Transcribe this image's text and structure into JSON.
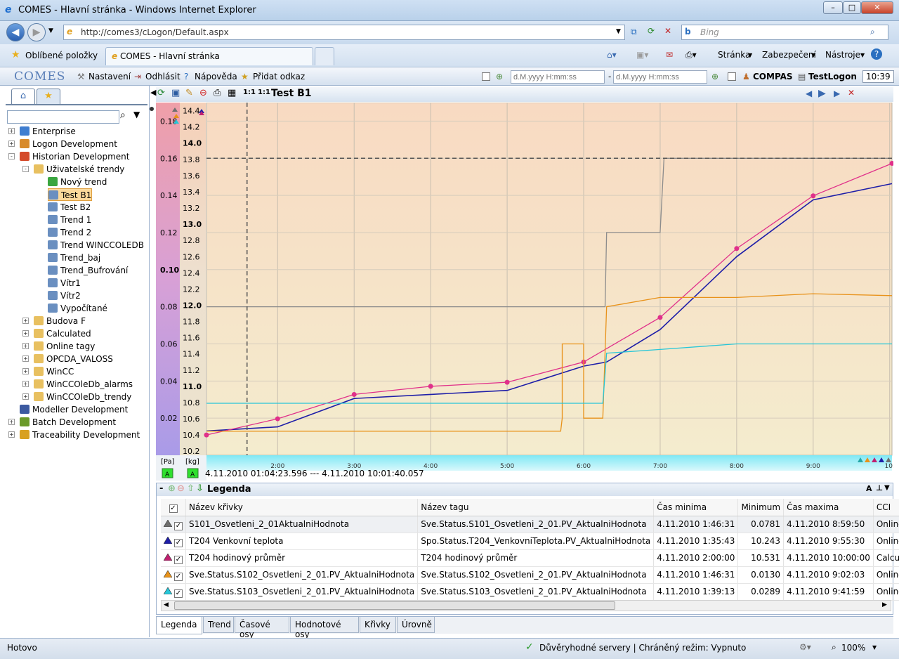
{
  "window": {
    "title": "COMES - Hlavní stránka - Windows Internet Explorer"
  },
  "address": {
    "url": "http://comes3/cLogon/Default.aspx",
    "search_placeholder": "Bing"
  },
  "ie_tabs": {
    "favorites": "Oblíbené položky",
    "current_tab": "COMES - Hlavní stránka"
  },
  "ie_commands": {
    "page": "Stránka",
    "security": "Zabezpečení",
    "tools": "Nástroje"
  },
  "app_menu": {
    "logo": "COMES",
    "settings": "Nastavení",
    "logout": "Odhlásit",
    "help": "Nápověda",
    "add_link": "Přidat odkaz",
    "date_from_placeholder": "d.M.yyyy H:mm:ss",
    "date_sep": "-",
    "date_to_placeholder": "d.M.yyyy H:mm:ss",
    "user": "COMPAS",
    "logon": "TestLogon",
    "clock": "10:39"
  },
  "tree": [
    {
      "label": "Enterprise",
      "level": 0,
      "exp": "+",
      "icon": "globe-icon",
      "color": "#3f7ed0"
    },
    {
      "label": "Logon Development",
      "level": 0,
      "exp": "+",
      "icon": "logon-icon",
      "color": "#d88a2a"
    },
    {
      "label": "Historian Development",
      "level": 0,
      "exp": "-",
      "icon": "historian-icon",
      "color": "#d44a2a"
    },
    {
      "label": "Uživatelské trendy",
      "level": 1,
      "exp": "-",
      "icon": "folder-icon",
      "color": "#e8c060"
    },
    {
      "label": "Nový trend",
      "level": 2,
      "exp": "",
      "icon": "add-icon",
      "color": "#3aa640"
    },
    {
      "label": "Test B1",
      "level": 2,
      "exp": "",
      "icon": "trend-icon",
      "color": "#6a8fc0",
      "selected": true
    },
    {
      "label": "Test B2",
      "level": 2,
      "exp": "",
      "icon": "trend-icon",
      "color": "#6a8fc0"
    },
    {
      "label": "Trend 1",
      "level": 2,
      "exp": "",
      "icon": "trend-icon",
      "color": "#6a8fc0"
    },
    {
      "label": "Trend 2",
      "level": 2,
      "exp": "",
      "icon": "trend-icon",
      "color": "#6a8fc0"
    },
    {
      "label": "Trend WINCCOLEDB",
      "level": 2,
      "exp": "",
      "icon": "trend-icon",
      "color": "#6a8fc0"
    },
    {
      "label": "Trend_baj",
      "level": 2,
      "exp": "",
      "icon": "trend-icon",
      "color": "#6a8fc0"
    },
    {
      "label": "Trend_Bufrování",
      "level": 2,
      "exp": "",
      "icon": "trend-icon",
      "color": "#6a8fc0"
    },
    {
      "label": "Vítr1",
      "level": 2,
      "exp": "",
      "icon": "trend-icon",
      "color": "#6a8fc0"
    },
    {
      "label": "Vítr2",
      "level": 2,
      "exp": "",
      "icon": "trend-icon",
      "color": "#6a8fc0"
    },
    {
      "label": "Vypočítané",
      "level": 2,
      "exp": "",
      "icon": "trend-icon",
      "color": "#6a8fc0"
    },
    {
      "label": "Budova F",
      "level": 1,
      "exp": "+",
      "icon": "db-icon",
      "color": "#e8c060"
    },
    {
      "label": "Calculated",
      "level": 1,
      "exp": "+",
      "icon": "db-icon",
      "color": "#e8c060"
    },
    {
      "label": "Online tagy",
      "level": 1,
      "exp": "+",
      "icon": "db-icon",
      "color": "#e8c060"
    },
    {
      "label": "OPCDA_VALOSS",
      "level": 1,
      "exp": "+",
      "icon": "db-icon",
      "color": "#e8c060"
    },
    {
      "label": "WinCC",
      "level": 1,
      "exp": "+",
      "icon": "db-icon",
      "color": "#e8c060"
    },
    {
      "label": "WinCCOleDb_alarms",
      "level": 1,
      "exp": "+",
      "icon": "db-icon",
      "color": "#e8c060"
    },
    {
      "label": "WinCCOleDb_trendy",
      "level": 1,
      "exp": "+",
      "icon": "db-icon",
      "color": "#e8c060"
    },
    {
      "label": "Modeller Development",
      "level": 0,
      "exp": "",
      "icon": "modeller-icon",
      "color": "#3c5aa0"
    },
    {
      "label": "Batch Development",
      "level": 0,
      "exp": "+",
      "icon": "batch-icon",
      "color": "#6a9a2a"
    },
    {
      "label": "Traceability Development",
      "level": 0,
      "exp": "+",
      "icon": "trace-icon",
      "color": "#d8a020"
    }
  ],
  "trend_title": "Test B1",
  "axis_units": {
    "left": "[Pa]",
    "right": "[kg]",
    "left_status": "A",
    "right_status": "A"
  },
  "time_range": "4.11.2010 01:04:23.596 --- 4.11.2010 10:01:40.057",
  "chart_data": {
    "type": "line",
    "x_ticks": [
      "2:00",
      "3:00",
      "4:00",
      "5:00",
      "6:00",
      "7:00",
      "8:00",
      "9:00",
      "10:"
    ],
    "x_range": [
      1.07,
      10.03
    ],
    "y_left": {
      "unit": "[Pa]",
      "ylim": [
        0.0,
        0.19
      ],
      "ticks": [
        "0.18",
        "0.16",
        "0.14",
        "0.12",
        "0.10",
        "0.08",
        "0.06",
        "0.04",
        "0.02"
      ]
    },
    "y_right": {
      "unit": "[kg]",
      "ylim": [
        10.15,
        14.5
      ],
      "ticks": [
        "14.4",
        "14.2",
        "14.0",
        "13.8",
        "13.6",
        "13.4",
        "13.2",
        "13.0",
        "12.8",
        "12.6",
        "12.4",
        "12.2",
        "12.0",
        "11.8",
        "11.6",
        "11.4",
        "11.2",
        "11.0",
        "10.8",
        "10.6",
        "10.4",
        "10.2"
      ]
    },
    "cursor": {
      "x": 1.6,
      "y_left": 0.16
    },
    "series": [
      {
        "name": "S101_Osvetleni_2_01AktualniHodnota",
        "color": "#8c8c8c",
        "axis": "left",
        "points": [
          [
            1.07,
            0.08
          ],
          [
            6.28,
            0.08
          ],
          [
            6.3,
            0.12
          ],
          [
            7.0,
            0.12
          ],
          [
            7.05,
            0.16
          ],
          [
            10.03,
            0.16
          ]
        ]
      },
      {
        "name": "T204 Venkovní teplota",
        "color": "#1e1ea8",
        "axis": "right",
        "points": [
          [
            1.07,
            10.45
          ],
          [
            2.0,
            10.5
          ],
          [
            3.0,
            10.85
          ],
          [
            4.0,
            10.9
          ],
          [
            5.0,
            10.95
          ],
          [
            6.0,
            11.25
          ],
          [
            6.3,
            11.3
          ],
          [
            7.0,
            11.7
          ],
          [
            8.0,
            12.6
          ],
          [
            9.0,
            13.3
          ],
          [
            10.03,
            13.5
          ]
        ]
      },
      {
        "name": "T204 hodinový průměr",
        "color": "#e0308a",
        "axis": "right",
        "markers": true,
        "points": [
          [
            1.07,
            10.4
          ],
          [
            2.0,
            10.6
          ],
          [
            3.0,
            10.9
          ],
          [
            4.0,
            11.0
          ],
          [
            5.0,
            11.05
          ],
          [
            6.0,
            11.3
          ],
          [
            7.0,
            11.85
          ],
          [
            8.0,
            12.7
          ],
          [
            9.0,
            13.35
          ],
          [
            10.03,
            13.75
          ]
        ]
      },
      {
        "name": "Sve.Status.S102_Osvetleni_2_01.PV_AktualniHodnota",
        "color": "#e8921a",
        "axis": "left",
        "points": [
          [
            1.07,
            0.013
          ],
          [
            5.7,
            0.013
          ],
          [
            5.72,
            0.02
          ],
          [
            5.72,
            0.06
          ],
          [
            6.0,
            0.06
          ],
          [
            6.0,
            0.02
          ],
          [
            6.25,
            0.02
          ],
          [
            6.3,
            0.08
          ],
          [
            7.0,
            0.085
          ],
          [
            8.0,
            0.085
          ],
          [
            9.0,
            0.087
          ],
          [
            10.03,
            0.086
          ]
        ]
      },
      {
        "name": "Sve.Status.S103_Osvetleni_2_01.PV_AktualniHodnota",
        "color": "#26c6d8",
        "axis": "left",
        "points": [
          [
            1.07,
            0.028
          ],
          [
            6.25,
            0.028
          ],
          [
            6.3,
            0.055
          ],
          [
            7.0,
            0.057
          ],
          [
            8.0,
            0.06
          ],
          [
            9.0,
            0.06
          ],
          [
            10.03,
            0.06
          ]
        ]
      }
    ]
  },
  "legend": {
    "title": "Legenda",
    "columns": [
      "Název křivky",
      "Název tagu",
      "Čas minima",
      "Minimum",
      "Čas maxima",
      "CCI"
    ],
    "rows": [
      {
        "marker_color": "#6e6e6e",
        "curve": "S101_Osvetleni_2_01AktualniHodnota",
        "tag": "Sve.Status.S101_Osvetleni_2_01.PV_AktualniHodnota",
        "tmin": "4.11.2010 1:46:31",
        "min": "0.0781",
        "tmax": "4.11.2010 8:59:50",
        "cci": "Online"
      },
      {
        "marker_color": "#1e1ea8",
        "curve": "T204 Venkovní teplota",
        "tag": "Spo.Status.T204_VenkovniTeplota.PV_AktualniHodnota",
        "tmin": "4.11.2010 1:35:43",
        "min": "10.243",
        "tmax": "4.11.2010 9:55:30",
        "cci": "Online"
      },
      {
        "marker_color": "#c02070",
        "curve": "T204 hodinový průměr",
        "tag": "T204 hodinový průměr",
        "tmin": "4.11.2010 2:00:00",
        "min": "10.531",
        "tmax": "4.11.2010 10:00:00",
        "cci": "Calcula"
      },
      {
        "marker_color": "#e8921a",
        "curve": "Sve.Status.S102_Osvetleni_2_01.PV_AktualniHodnota",
        "tag": "Sve.Status.S102_Osvetleni_2_01.PV_AktualniHodnota",
        "tmin": "4.11.2010 1:46:31",
        "min": "0.0130",
        "tmax": "4.11.2010 9:02:03",
        "cci": "Online"
      },
      {
        "marker_color": "#26c6d8",
        "curve": "Sve.Status.S103_Osvetleni_2_01.PV_AktualniHodnota",
        "tag": "Sve.Status.S103_Osvetleni_2_01.PV_AktualniHodnota",
        "tmin": "4.11.2010 1:39:13",
        "min": "0.0289",
        "tmax": "4.11.2010 9:41:59",
        "cci": "Online"
      }
    ]
  },
  "bottom_tabs": [
    "Legenda",
    "Trend",
    "Časové osy",
    "Hodnotové osy",
    "Křivky",
    "Úrovně"
  ],
  "statusbar": {
    "left": "Hotovo",
    "trusted": "Důvěryhodné servery | Chráněný režim: Vypnuto",
    "zoom": "100%"
  }
}
